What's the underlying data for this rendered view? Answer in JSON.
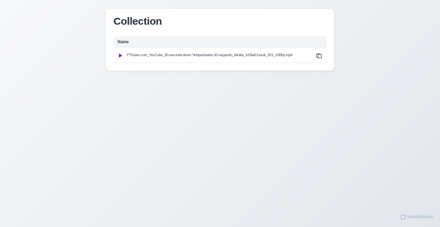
{
  "page": {
    "title": "Collection"
  },
  "table": {
    "columns": [
      "Name"
    ],
    "rows": [
      {
        "icon": "play-icon",
        "name": "YTDown.com_YouTube_30-seconds-timer-Temporizador-30-segundo_Media_X29taF1esuk_001_1080p.mp4",
        "action_icon": "copy-icon"
      }
    ]
  },
  "branding": {
    "label": "ScanMalware"
  },
  "colors": {
    "accent": "#8b1d8f",
    "title": "#1f2937",
    "header_bg": "#f3f4f6"
  }
}
